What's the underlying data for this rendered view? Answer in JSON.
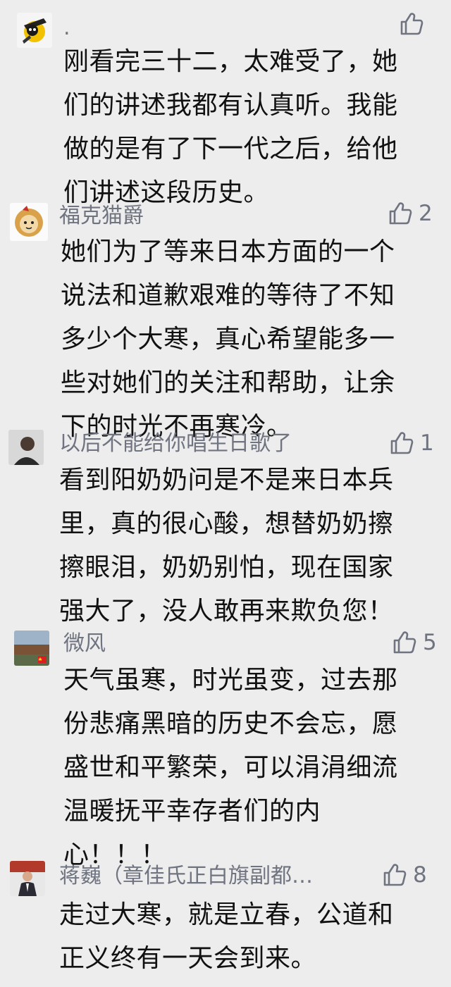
{
  "comments": [
    {
      "author": ".",
      "avatar_icon": "black-cat-ninja-avatar",
      "likes": "",
      "lines": [
        "刚看完三十二，太难受了，她",
        "们的讲述我都有认真听。我能",
        "做的是有了下一代之后，给他",
        "们讲述这段历史。"
      ]
    },
    {
      "author": "福克猫爵",
      "avatar_icon": "lion-cartoon-avatar",
      "likes": "2",
      "lines": [
        "她们为了等来日本方面的一个",
        "说法和道歉艰难的等待了不知",
        "多少个大寒，真心希望能多一",
        "些对她们的关注和帮助，让余",
        "下的时光不再寒冷。"
      ]
    },
    {
      "author": "以后不能给你唱生日歌了",
      "avatar_icon": "man-portrait-avatar",
      "likes": "1",
      "lines": [
        "看到阳奶奶问是不是来日本兵",
        "里，真的很心酸，想替奶奶擦",
        "擦眼泪，奶奶别怕，现在国家",
        "强大了，没人敢再来欺负您！"
      ]
    },
    {
      "author": "微风",
      "avatar_icon": "outdoor-photo-avatar",
      "likes": "5",
      "lines": [
        "天气虽寒，时光虽变，过去那",
        "份悲痛黑暗的历史不会忘，愿",
        "盛世和平繁荣，可以涓涓细流",
        "温暖抚平幸存者们的内",
        "心！！！"
      ]
    },
    {
      "author": "蒋巍（章佳氏正白旗副都…",
      "avatar_icon": "man-in-suit-avatar",
      "likes": "8",
      "lines": [
        "走过大寒，就是立春，公道和",
        "正义终有一天会到来。"
      ]
    }
  ],
  "colors": {
    "background": "#ededed",
    "author": "#6f7480",
    "body": "#111111"
  }
}
